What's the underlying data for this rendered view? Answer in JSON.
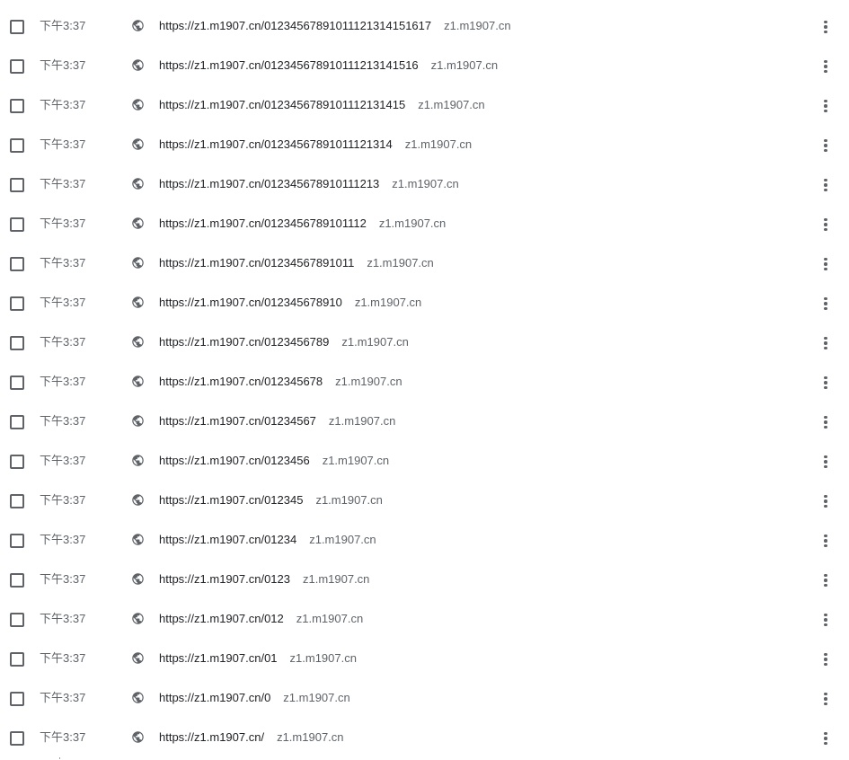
{
  "history": {
    "items": [
      {
        "time": "下午3:37",
        "url": "https://z1.m1907.cn/01234567891011121314151617",
        "domain": "z1.m1907.cn"
      },
      {
        "time": "下午3:37",
        "url": "https://z1.m1907.cn/012345678910111213141516",
        "domain": "z1.m1907.cn"
      },
      {
        "time": "下午3:37",
        "url": "https://z1.m1907.cn/0123456789101112131415",
        "domain": "z1.m1907.cn"
      },
      {
        "time": "下午3:37",
        "url": "https://z1.m1907.cn/01234567891011121314",
        "domain": "z1.m1907.cn"
      },
      {
        "time": "下午3:37",
        "url": "https://z1.m1907.cn/012345678910111213",
        "domain": "z1.m1907.cn"
      },
      {
        "time": "下午3:37",
        "url": "https://z1.m1907.cn/0123456789101112",
        "domain": "z1.m1907.cn"
      },
      {
        "time": "下午3:37",
        "url": "https://z1.m1907.cn/01234567891011",
        "domain": "z1.m1907.cn"
      },
      {
        "time": "下午3:37",
        "url": "https://z1.m1907.cn/012345678910",
        "domain": "z1.m1907.cn"
      },
      {
        "time": "下午3:37",
        "url": "https://z1.m1907.cn/0123456789",
        "domain": "z1.m1907.cn"
      },
      {
        "time": "下午3:37",
        "url": "https://z1.m1907.cn/012345678",
        "domain": "z1.m1907.cn"
      },
      {
        "time": "下午3:37",
        "url": "https://z1.m1907.cn/01234567",
        "domain": "z1.m1907.cn"
      },
      {
        "time": "下午3:37",
        "url": "https://z1.m1907.cn/0123456",
        "domain": "z1.m1907.cn"
      },
      {
        "time": "下午3:37",
        "url": "https://z1.m1907.cn/012345",
        "domain": "z1.m1907.cn"
      },
      {
        "time": "下午3:37",
        "url": "https://z1.m1907.cn/01234",
        "domain": "z1.m1907.cn"
      },
      {
        "time": "下午3:37",
        "url": "https://z1.m1907.cn/0123",
        "domain": "z1.m1907.cn"
      },
      {
        "time": "下午3:37",
        "url": "https://z1.m1907.cn/012",
        "domain": "z1.m1907.cn"
      },
      {
        "time": "下午3:37",
        "url": "https://z1.m1907.cn/01",
        "domain": "z1.m1907.cn"
      },
      {
        "time": "下午3:37",
        "url": "https://z1.m1907.cn/0",
        "domain": "z1.m1907.cn"
      },
      {
        "time": "下午3:37",
        "url": "https://z1.m1907.cn/",
        "domain": "z1.m1907.cn"
      }
    ],
    "icons": {
      "checkbox": "checkbox-unchecked",
      "favicon": "globe-icon",
      "menu": "more-vert-icon"
    },
    "colors": {
      "text_primary": "#202124",
      "text_secondary": "#5f6368"
    }
  }
}
